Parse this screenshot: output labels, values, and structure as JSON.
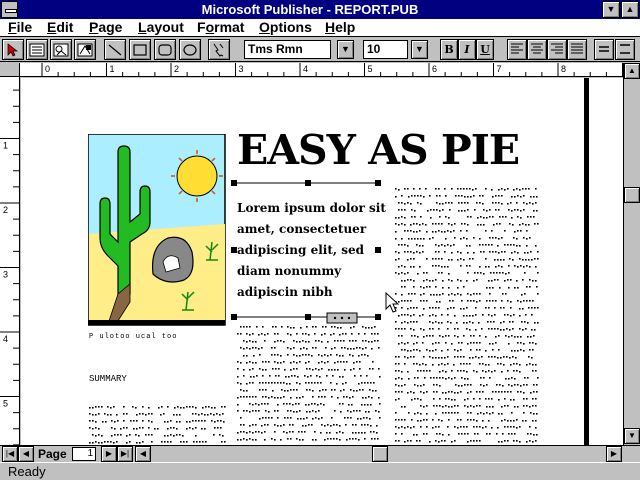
{
  "window": {
    "title": "Microsoft Publisher - REPORT.PUB"
  },
  "menu": [
    {
      "label_first": "F",
      "label_rest": "ile"
    },
    {
      "label_first": "E",
      "label_rest": "dit"
    },
    {
      "label_first": "P",
      "label_rest": "age"
    },
    {
      "label_first": "L",
      "label_rest": "ayout"
    },
    {
      "label_first": "F",
      "label_rest": "ormat",
      "rest_underline": "o"
    },
    {
      "label_first": "O",
      "label_rest": "ptions"
    },
    {
      "label_first": "H",
      "label_rest": "elp"
    }
  ],
  "toolbar": {
    "font_name": "Tms Rmn",
    "font_size": "10",
    "bold_label": "B",
    "italic_label": "I",
    "underline_label": "U"
  },
  "rulers": {
    "h_labels": [
      "0",
      "1",
      "2",
      "3",
      "4",
      "5",
      "6",
      "7",
      "8",
      "9"
    ],
    "v_labels": [
      "1",
      "2",
      "3",
      "4",
      "5"
    ]
  },
  "document": {
    "headline": "EASY AS PIE",
    "body_lines": [
      "Lorem ipsum dolor sit",
      "amet, consectetuer",
      "adipiscing elit, sed",
      "diam nonummy",
      "adipiscin nibh"
    ],
    "caption": "P ulotoo ucal too",
    "summary_heading": "SUMMARY"
  },
  "nav": {
    "page_label": "Page",
    "page_number": "1"
  },
  "status": {
    "text": "Ready"
  },
  "colors": {
    "titlebar": "#000080",
    "sky": "#aaeeff",
    "sand": "#ffee88",
    "cactus": "#22bb22",
    "sun": "#ffdd33"
  }
}
